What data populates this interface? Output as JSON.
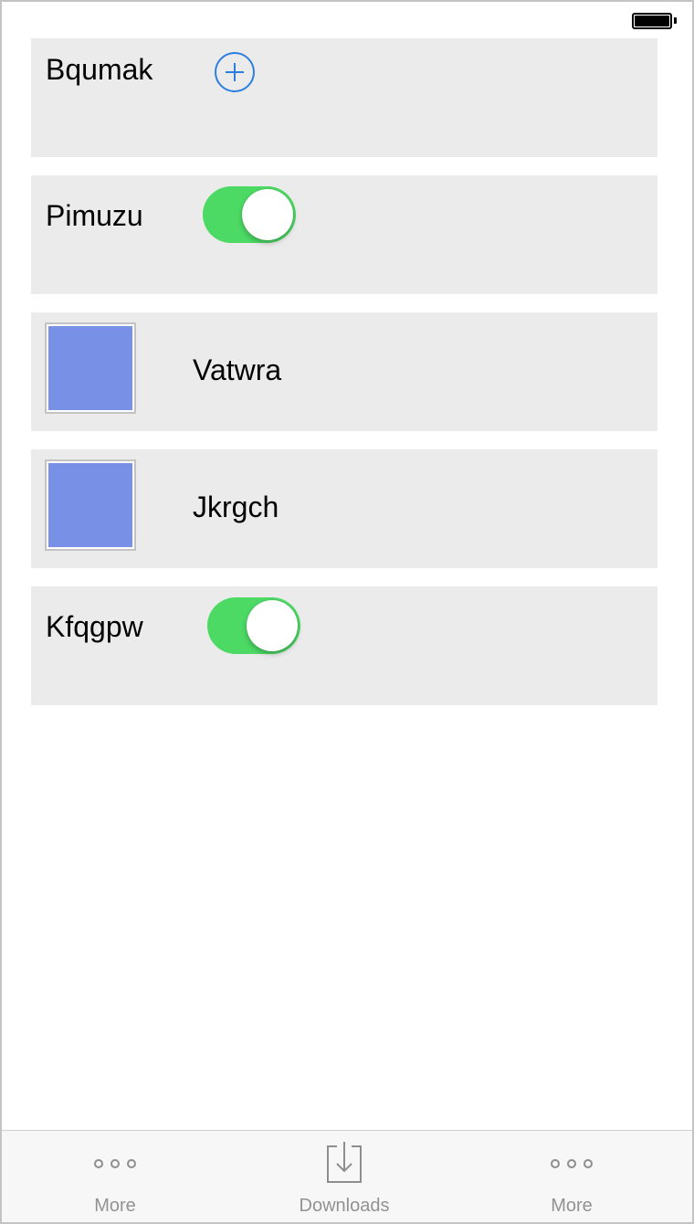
{
  "status_bar": {
    "battery_icon": "battery-full-icon"
  },
  "rows": [
    {
      "type": "plus",
      "label": "Bqumak",
      "icon": "plus-circle-icon",
      "accent": "#2a7fe0"
    },
    {
      "type": "toggle",
      "label": "Pimuzu",
      "on": true,
      "accent": "#4cd964"
    },
    {
      "type": "swatch",
      "label": "Vatwra",
      "color": "#7891e6"
    },
    {
      "type": "swatch",
      "label": "Jkrgch",
      "color": "#7891e6"
    },
    {
      "type": "toggle",
      "label": "Kfqgpw",
      "on": true,
      "accent": "#4cd964"
    }
  ],
  "tab_bar": {
    "tabs": [
      {
        "label": "More",
        "icon": "more-dots-icon"
      },
      {
        "label": "Downloads",
        "icon": "download-icon"
      },
      {
        "label": "More",
        "icon": "more-dots-icon"
      }
    ]
  }
}
